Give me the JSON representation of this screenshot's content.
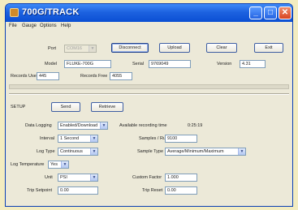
{
  "window": {
    "title": "700G/TRACK"
  },
  "menu": [
    "File",
    "Gauge",
    "Options",
    "Help"
  ],
  "connection": {
    "port_label": "Port",
    "port_value": "COM16",
    "disconnect_label": "Disconnect",
    "upload_label": "Upload",
    "clear_label": "Clear",
    "exit_label": "Exit"
  },
  "info": {
    "model_label": "Model",
    "model_value": "FLUKE-700G",
    "serial_label": "Serial",
    "serial_value": "9769049",
    "version_label": "Version",
    "version_value": "4.31",
    "records_used_label": "Records Used",
    "records_used_value": "445",
    "records_free_label": "Records Free",
    "records_free_value": "4055"
  },
  "setup": {
    "title": "SETUP",
    "send_label": "Send",
    "retrieve_label": "Retrieve",
    "data_logging_label": "Data Logging",
    "data_logging_value": "Enabled/Download",
    "available_time_label": "Available recording time",
    "available_time_value": "0:25:19",
    "interval_label": "Interval",
    "interval_value": "1 Second",
    "samples_run_label": "Samples / Run",
    "samples_run_value": "9100",
    "log_type_label": "Log Type",
    "log_type_value": "Continuous",
    "sample_type_label": "Sample Type",
    "sample_type_value": "Average/Minimum/Maximum",
    "log_temp_label": "Log Temperature",
    "log_temp_value": "Yes",
    "unit_label": "Unit",
    "unit_value": "PSI",
    "custom_factor_label": "Custom Factor",
    "custom_factor_value": "1.000",
    "trip_setpoint_label": "Trip Setpoint",
    "trip_setpoint_value": "0.00",
    "trip_reset_label": "Trip Reset",
    "trip_reset_value": "0.00"
  },
  "colors": {
    "titlebar": "#1d62e0",
    "window_bg": "#ece9d8",
    "frame": "#f3ecc0",
    "close": "#d84421"
  },
  "icons": {
    "app": "app-icon",
    "minimize": "minimize-icon",
    "maximize": "maximize-icon",
    "close": "close-icon",
    "dropdown": "chevron-down-icon"
  }
}
